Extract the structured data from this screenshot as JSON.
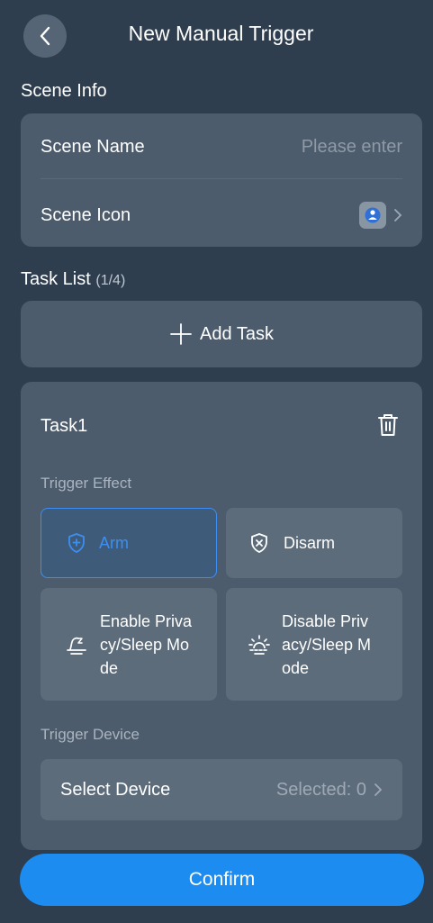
{
  "header": {
    "title": "New Manual Trigger",
    "back_icon": "chevron-left-icon"
  },
  "scene_info": {
    "section_label": "Scene Info",
    "name_label": "Scene Name",
    "name_placeholder": "Please enter",
    "icon_label": "Scene Icon",
    "icon": "person-icon"
  },
  "task_list": {
    "section_label": "Task List",
    "count": "(1/4)",
    "add_label": "Add Task"
  },
  "task": {
    "title": "Task1",
    "trigger_effect_label": "Trigger Effect",
    "options": [
      {
        "label": "Arm",
        "icon": "shield-plus-icon",
        "selected": true
      },
      {
        "label": "Disarm",
        "icon": "shield-x-icon",
        "selected": false
      },
      {
        "label_lines": [
          "Enable Priva",
          "cy/Sleep Mo",
          "de"
        ],
        "icon": "bell-sleep-icon",
        "selected": false
      },
      {
        "label_lines": [
          "Disable Priv",
          "acy/Sleep M",
          "ode"
        ],
        "icon": "sun-rise-icon",
        "selected": false
      }
    ],
    "trigger_device_label": "Trigger Device",
    "device_select_label": "Select Device",
    "device_selected_value": "Selected: 0"
  },
  "colors": {
    "accent": "#1d8cf0",
    "background": "#2e3e4e",
    "card": "#4c5c6c"
  },
  "confirm_label": "Confirm"
}
